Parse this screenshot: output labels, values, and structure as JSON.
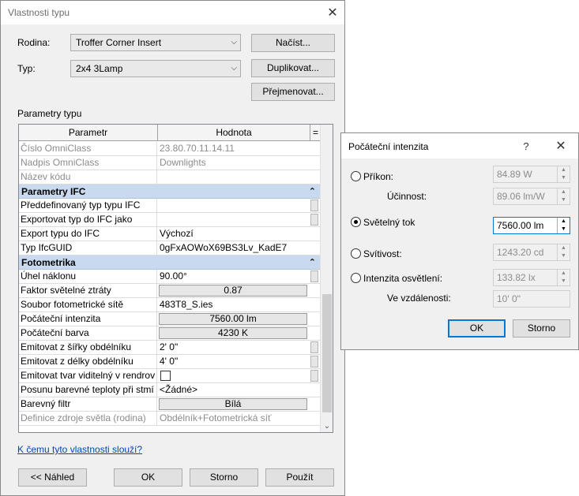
{
  "main_dialog": {
    "title": "Vlastnosti typu",
    "family_label": "Rodina:",
    "family_value": "Troffer Corner Insert",
    "type_label": "Typ:",
    "type_value": "2x4 3Lamp",
    "load_button": "Načíst...",
    "duplicate_button": "Duplikovat...",
    "rename_button": "Přejmenovat...",
    "type_params_label": "Parametry typu",
    "grid": {
      "col_param": "Parametr",
      "col_value": "Hodnota",
      "col_eq": "=",
      "rows": [
        {
          "name": "Číslo OmniClass",
          "value": "23.80.70.11.14.11"
        },
        {
          "name": "Nadpis OmniClass",
          "value": "Downlights"
        },
        {
          "name": "Název kódu",
          "value": ""
        },
        {
          "group": "Parametry IFC"
        },
        {
          "name": "Předdefinovaný typ typu IFC",
          "value": ""
        },
        {
          "name": "Exportovat typ do IFC jako",
          "value": ""
        },
        {
          "name": "Export typu do IFC",
          "value": "Výchozí"
        },
        {
          "name": "Typ IfcGUID",
          "value": "0gFxAOWoX69BS3Lv_KadE7"
        },
        {
          "group": "Fotometrika"
        },
        {
          "name": "Úhel náklonu",
          "value": "90.00°"
        },
        {
          "name": "Faktor světelné ztráty",
          "value": "0.87"
        },
        {
          "name": "Soubor fotometrické sítě",
          "value": "483T8_S.ies"
        },
        {
          "name": "Počáteční intenzita",
          "value": "7560.00 lm"
        },
        {
          "name": "Počáteční barva",
          "value": "4230 K"
        },
        {
          "name": "Emitovat z šířky obdélníku",
          "value": "2'  0\""
        },
        {
          "name": "Emitovat z délky obdélníku",
          "value": "4'  0\""
        },
        {
          "name": "Emitovat tvar viditelný v rendrov",
          "value": ""
        },
        {
          "name": "Posunu barevné teploty při stmí",
          "value": "<Žádné>"
        },
        {
          "name": "Barevný filtr",
          "value": "Bílá"
        },
        {
          "name": "Definice zdroje světla (rodina)",
          "value": "Obdélník+Fotometrická síť"
        }
      ]
    },
    "help_link": "K čemu tyto vlastnosti slouží?",
    "preview_button": "<< Náhled",
    "ok_button": "OK",
    "cancel_button": "Storno",
    "apply_button": "Použít"
  },
  "intensity_dialog": {
    "title": "Počáteční intenzita",
    "help_glyph": "?",
    "wattage_label": "Příkon:",
    "wattage_value": "84.89 W",
    "efficacy_label": "Účinnost:",
    "efficacy_value": "89.06 lm/W",
    "flux_label": "Světelný tok",
    "flux_value": "7560.00 lm",
    "intensity_label": "Svítivost:",
    "intensity_value": "1243.20 cd",
    "illuminance_label": "Intenzita osvětlení:",
    "illuminance_value": "133.82 lx",
    "distance_label": "Ve vzdálenosti:",
    "distance_value": "10'  0\"",
    "ok_button": "OK",
    "cancel_button": "Storno"
  }
}
